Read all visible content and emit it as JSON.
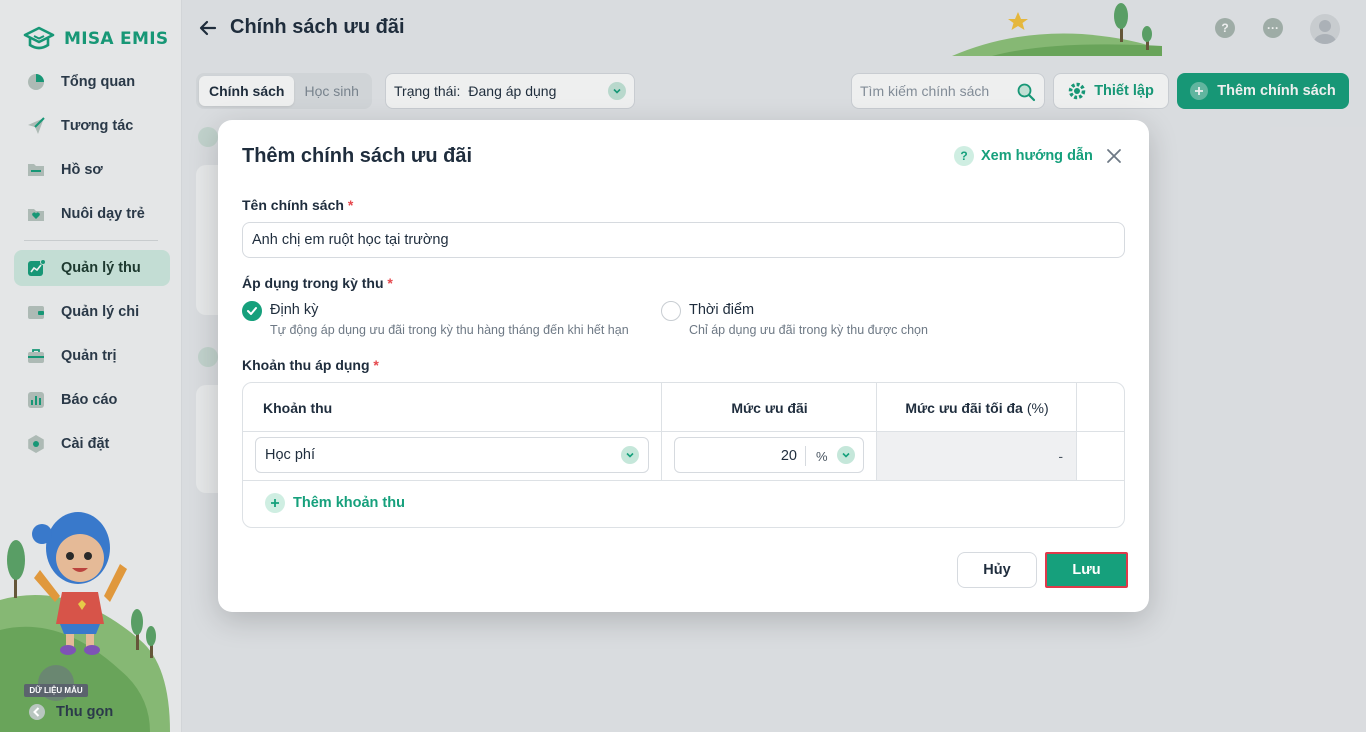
{
  "app": {
    "logo_text": "MISA EMIS",
    "sample_badge": "DỮ LIỆU MẪU",
    "collapse_label": "Thu gọn"
  },
  "sidebar": {
    "items": [
      {
        "label": "Tổng quan",
        "icon": "pie-chart-icon"
      },
      {
        "label": "Tương tác",
        "icon": "paper-plane-icon"
      },
      {
        "label": "Hồ sơ",
        "icon": "folder-icon"
      },
      {
        "label": "Nuôi dạy trẻ",
        "icon": "heart-folder-icon"
      },
      {
        "label": "Quản lý thu",
        "icon": "income-chart-icon",
        "active": true
      },
      {
        "label": "Quản lý chi",
        "icon": "wallet-icon"
      },
      {
        "label": "Quản trị",
        "icon": "briefcase-icon"
      },
      {
        "label": "Báo cáo",
        "icon": "bar-chart-icon"
      },
      {
        "label": "Cài đặt",
        "icon": "gear-icon"
      }
    ]
  },
  "header": {
    "title": "Chính sách ưu đãi"
  },
  "toolbar": {
    "tabs": [
      {
        "label": "Chính sách",
        "active": true
      },
      {
        "label": "Học sinh",
        "active": false
      }
    ],
    "status_label": "Trạng thái:",
    "status_value": "Đang áp dụng",
    "search_placeholder": "Tìm kiếm chính sách",
    "setup_label": "Thiết lập",
    "add_label": "Thêm chính sách"
  },
  "modal": {
    "title": "Thêm chính sách ưu đãi",
    "help_label": "Xem hướng dẫn",
    "name_label": "Tên chính sách",
    "name_value": "Anh chị em ruột học tại trường",
    "period_label": "Áp dụng trong kỳ thu",
    "options": [
      {
        "title": "Định kỳ",
        "desc": "Tự động áp dụng ưu đãi trong kỳ thu hàng tháng đến khi hết hạn",
        "checked": true
      },
      {
        "title": "Thời điểm",
        "desc": "Chỉ áp dụng ưu đãi trong kỳ thu được chọn",
        "checked": false
      }
    ],
    "fees_label": "Khoản thu áp dụng",
    "table": {
      "col_fee": "Khoản thu",
      "col_rate": "Mức ưu đãi",
      "col_max": "Mức ưu đãi tối đa",
      "col_max_unit": "(%)",
      "rows": [
        {
          "fee": "Học phí",
          "rate": "20",
          "unit": "%",
          "max": "-"
        }
      ]
    },
    "add_fee_label": "Thêm khoản thu",
    "cancel_label": "Hủy",
    "save_label": "Lưu"
  },
  "colors": {
    "brand": "#16a07c",
    "active_nav_bg": "#d1ece2",
    "required": "#e5484d",
    "highlight_border": "#e0394a"
  }
}
